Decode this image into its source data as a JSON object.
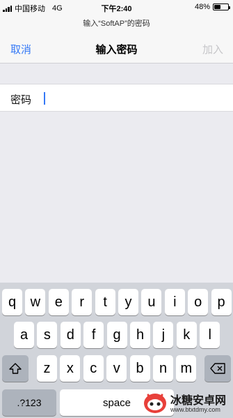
{
  "status_bar": {
    "carrier": "中国移动",
    "network": "4G",
    "time": "下午2:40",
    "battery_text": "48%",
    "battery_level": 0.48
  },
  "prompt": "输入“SoftAP”的密码",
  "nav": {
    "cancel_label": "取消",
    "title": "输入密码",
    "join_label": "加入"
  },
  "form": {
    "password_label": "密码",
    "password_value": ""
  },
  "keyboard": {
    "row1": [
      "q",
      "w",
      "e",
      "r",
      "t",
      "y",
      "u",
      "i",
      "o",
      "p"
    ],
    "row2": [
      "a",
      "s",
      "d",
      "f",
      "g",
      "h",
      "j",
      "k",
      "l"
    ],
    "row3": [
      "z",
      "x",
      "c",
      "v",
      "b",
      "n",
      "m"
    ],
    "shift_icon": "shift-icon",
    "delete_icon": "delete-icon",
    "numbers_label": ".?123",
    "space_label": "space"
  },
  "watermark": {
    "title": "冰糖安卓网",
    "url": "www.btxtdmy.com"
  },
  "colors": {
    "accent": "#3478f6",
    "disabled": "#c6c6c9",
    "keyboard_bg": "#d1d4da"
  }
}
